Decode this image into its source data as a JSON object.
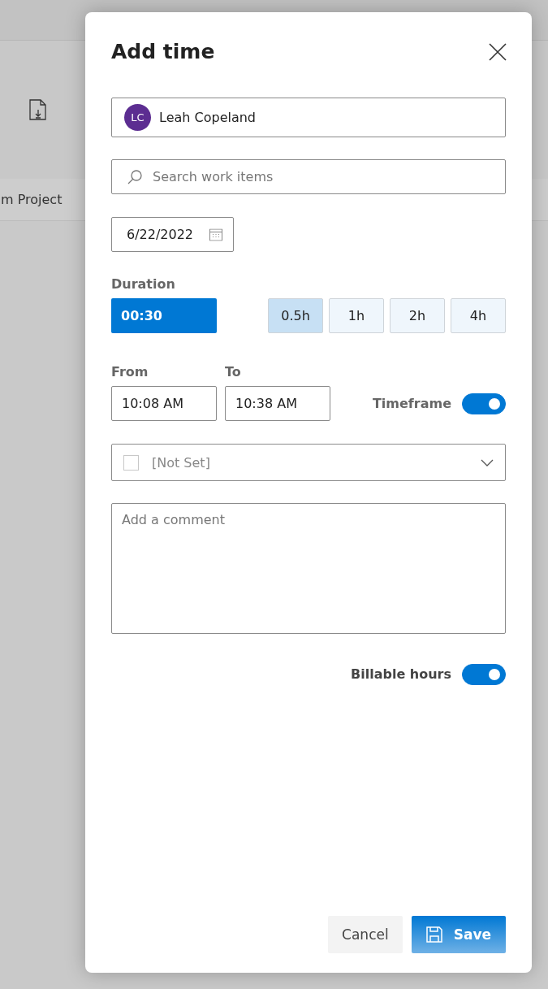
{
  "background": {
    "tab_text": "m Project"
  },
  "dialog": {
    "title": "Add time"
  },
  "person": {
    "initials": "LC",
    "name": "Leah Copeland"
  },
  "search": {
    "placeholder": "Search work items"
  },
  "date": {
    "value": "6/22/2022"
  },
  "duration": {
    "label": "Duration",
    "value": "00:30",
    "presets": [
      {
        "label": "0.5h",
        "selected": true
      },
      {
        "label": "1h",
        "selected": false
      },
      {
        "label": "2h",
        "selected": false
      },
      {
        "label": "4h",
        "selected": false
      }
    ]
  },
  "from": {
    "label": "From",
    "value": "10:08 AM"
  },
  "to": {
    "label": "To",
    "value": "10:38 AM"
  },
  "timeframe": {
    "label": "Timeframe",
    "on": true
  },
  "category": {
    "value": "[Not Set]",
    "checked": false
  },
  "comment": {
    "placeholder": "Add a comment"
  },
  "billable": {
    "label": "Billable hours",
    "on": true
  },
  "buttons": [
    {
      "label": "Cancel",
      "kind": "secondary"
    },
    {
      "label": "Save",
      "kind": "primary"
    }
  ]
}
